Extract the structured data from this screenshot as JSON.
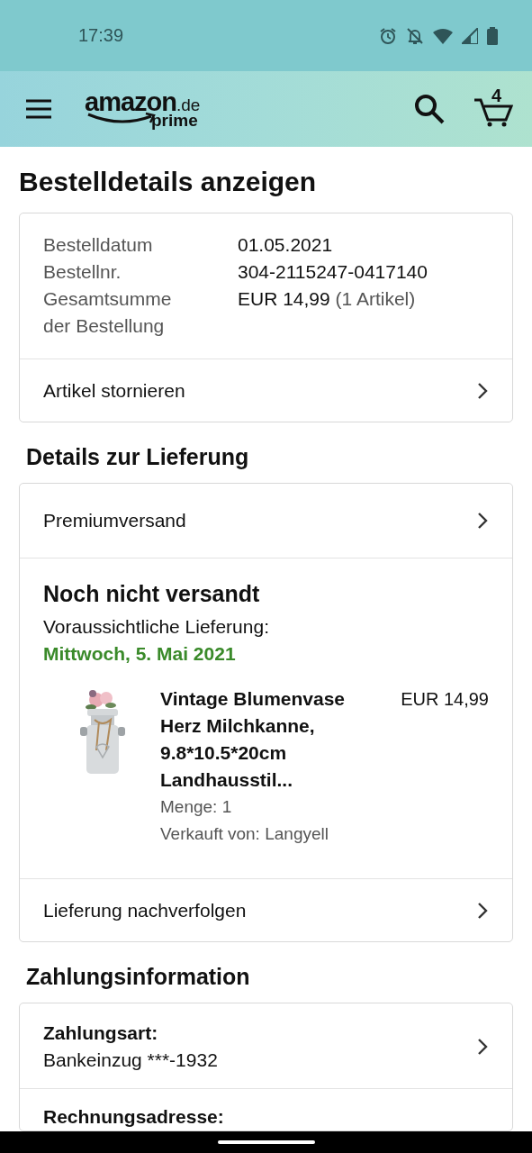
{
  "status_bar": {
    "time": "17:39"
  },
  "header": {
    "logo": {
      "brand": "amazon",
      "domain": ".de",
      "tier": "prime"
    },
    "cart_count": "4"
  },
  "title": "Bestelldetails anzeigen",
  "order_summary": {
    "fields": [
      {
        "label": "Bestelldatum",
        "value": "01.05.2021"
      },
      {
        "label": "Bestellnr.",
        "value": "304-2115247-0417140"
      },
      {
        "label": "Gesamtsumme der Bestellung",
        "value": "EUR 14,99",
        "note": "(1 Artikel)"
      }
    ],
    "action": "Artikel stornieren"
  },
  "delivery": {
    "heading": "Details zur Lieferung",
    "shipping_option": "Premiumversand",
    "status": "Noch nicht versandt",
    "eta_label": "Voraussichtliche Lieferung:",
    "eta_date": "Mittwoch, 5. Mai 2021",
    "items": [
      {
        "title": "Vintage Blumenvase Herz Milchkanne, 9.8*10.5*20cm Landhausstil...",
        "price": "EUR 14,99",
        "quantity": "Menge: 1",
        "seller": "Verkauft von: Langyell"
      }
    ],
    "action": "Lieferung nachverfolgen"
  },
  "payment": {
    "heading": "Zahlungsinformation",
    "rows": [
      {
        "label": "Zahlungsart:",
        "value": "Bankeinzug ***-1932"
      },
      {
        "label": "Rechnungsadresse:"
      }
    ]
  }
}
